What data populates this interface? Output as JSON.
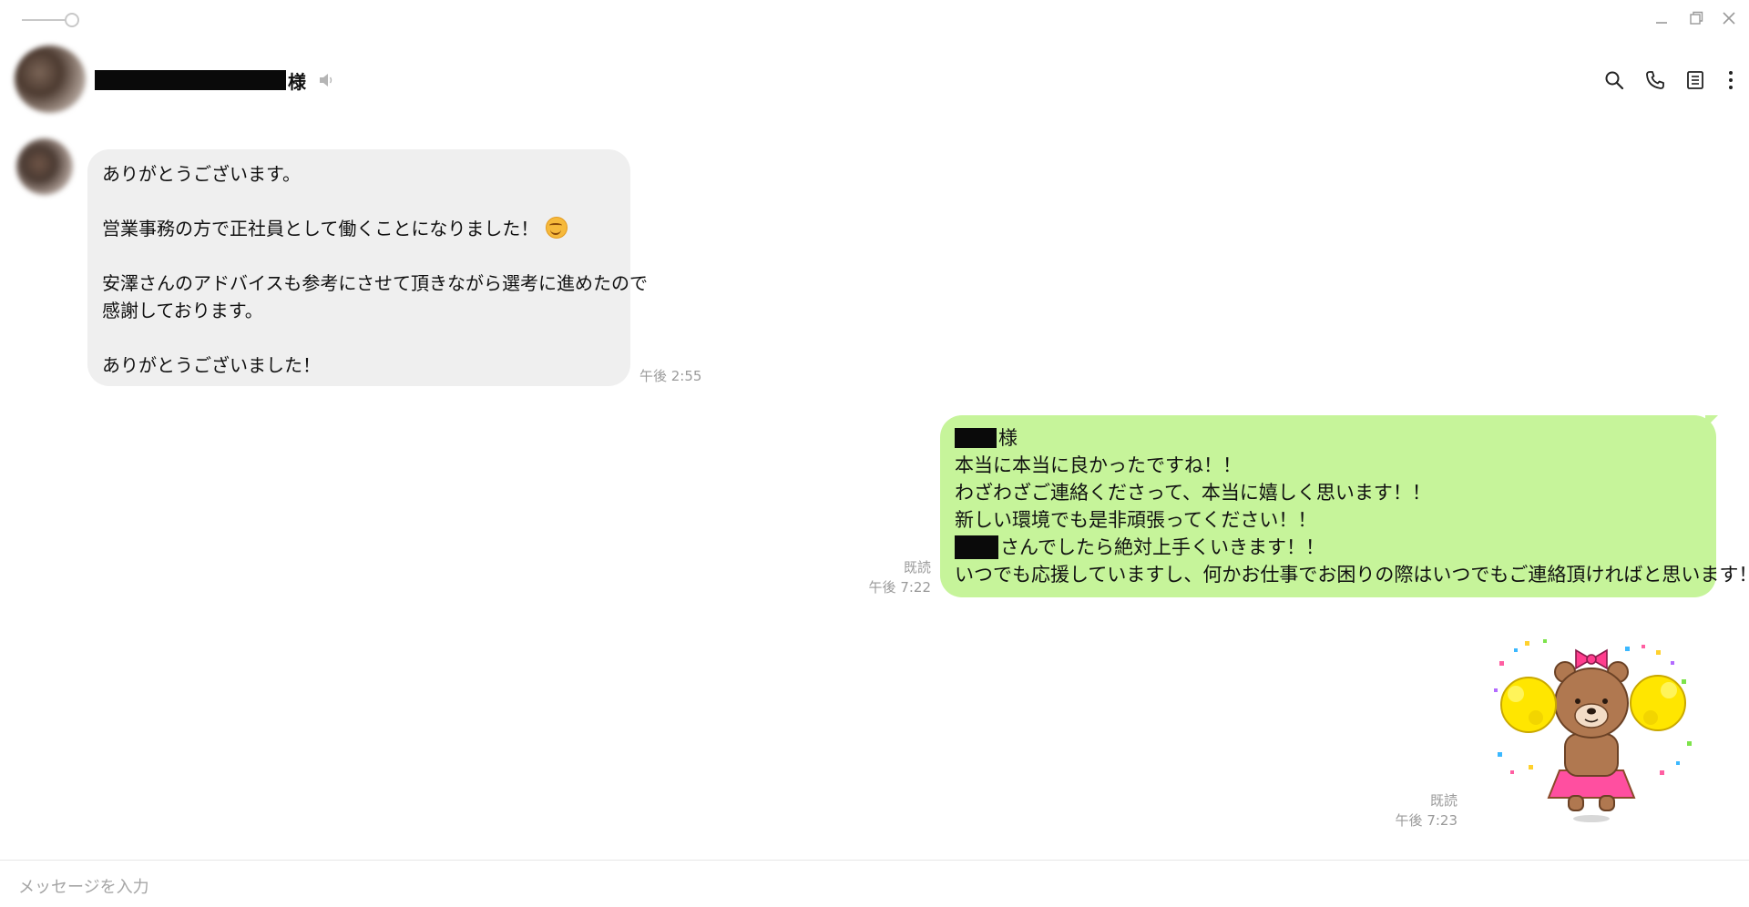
{
  "header": {
    "contact_suffix": "様"
  },
  "messages": {
    "incoming": {
      "lines": [
        "ありがとうございます。",
        "",
        "営業事務の方で正社員として働くことになりました！",
        "",
        "安澤さんのアドバイスも参考にさせて頂きながら選考に進めたので",
        "感謝しております。",
        "",
        "ありがとうございました！"
      ],
      "time": "午後 2:55"
    },
    "outgoing": {
      "line1_suffix": "様",
      "line2": "本当に本当に良かったですね！！",
      "line3": "わざわざご連絡くださって、本当に嬉しく思います！！",
      "line4": "新しい環境でも是非頑張ってください！！",
      "line5_suffix": "さんでしたら絶対上手くいきます！！",
      "line6": "いつでも応援していますし、何かお仕事でお困りの際はいつでもご連絡頂ければと思います！！",
      "read": "既読",
      "time": "午後 7:22"
    },
    "sticker": {
      "read": "既読",
      "time": "午後 7:23"
    }
  },
  "input": {
    "placeholder": "メッセージを入力"
  },
  "colors": {
    "incoming_bubble": "#efefef",
    "outgoing_bubble": "#c6f49a",
    "meta_text": "#9a9a9a"
  },
  "icons": [
    "pin-icon",
    "minimize-icon",
    "maximize-icon",
    "close-icon",
    "mute-icon",
    "search-icon",
    "phone-icon",
    "notes-icon",
    "more-icon",
    "smile-emoji-icon"
  ]
}
